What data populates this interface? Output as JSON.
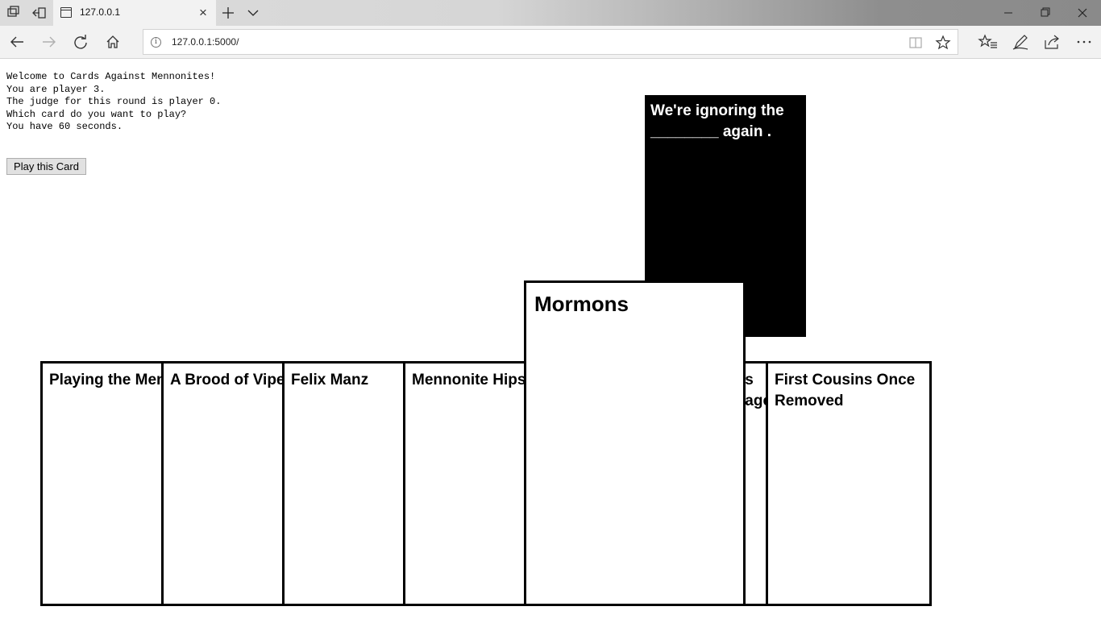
{
  "browser": {
    "tab_title": "127.0.0.1",
    "url": "127.0.0.1:5000/"
  },
  "game": {
    "messages": [
      "Welcome to Cards Against Mennonites!",
      "You are player 3.",
      "The judge for this round is player 0.",
      "Which card do you want to play?",
      "You have 60 seconds."
    ],
    "play_button_label": "Play this Card",
    "black_card_text": "We're ignoring the ________ again .",
    "hand": [
      "Playing the Mennonite Game",
      "A Brood of Vipers",
      "Felix Manz",
      "Mennonite Hipster",
      "Swiss Heritage",
      "First Cousins Once Removed"
    ],
    "selected_card": "Mormons"
  },
  "icons": {
    "tab_actions": "tab-actions-icon",
    "set_aside": "set-aside-tabs-icon",
    "new_tab": "plus-icon",
    "tab_list": "chevron-down-icon",
    "reading_view": "book-icon",
    "favorite": "star-icon",
    "favorites_hub": "favorites-list-icon",
    "notes": "pen-icon",
    "share": "share-icon",
    "more": "more-icon"
  }
}
